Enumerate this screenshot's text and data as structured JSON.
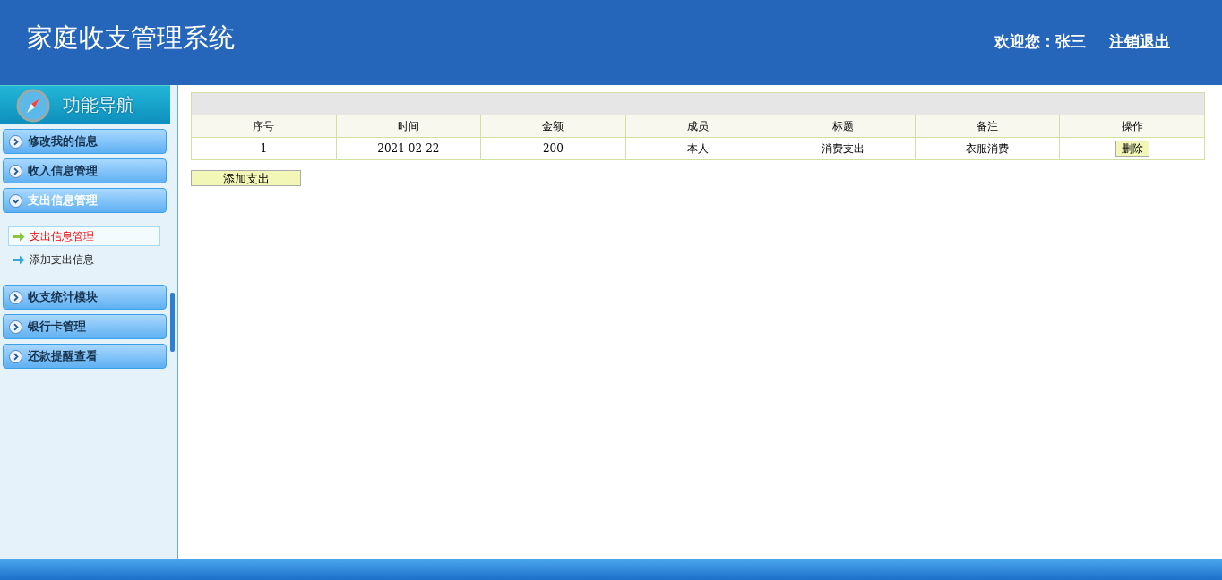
{
  "header": {
    "title": "家庭收支管理系统",
    "welcome": "欢迎您：张三",
    "logout": "注销退出"
  },
  "nav": {
    "title": "功能导航",
    "groups": [
      {
        "label": "修改我的信息",
        "expanded": false
      },
      {
        "label": "收入信息管理",
        "expanded": false
      },
      {
        "label": "支出信息管理",
        "expanded": true,
        "items": [
          {
            "label": "支出信息管理",
            "selected": true
          },
          {
            "label": "添加支出信息",
            "selected": false
          }
        ]
      },
      {
        "label": "收支统计模块",
        "expanded": false
      },
      {
        "label": "银行卡管理",
        "expanded": false
      },
      {
        "label": "还款提醒查看",
        "expanded": false
      }
    ]
  },
  "table": {
    "columns": [
      "序号",
      "时间",
      "金额",
      "成员",
      "标题",
      "备注",
      "操作"
    ],
    "rows": [
      {
        "cells": [
          "1",
          "2021-02-22",
          "200",
          "本人",
          "消费支出",
          "衣服消费"
        ],
        "action": "删除"
      }
    ]
  },
  "add_button": "添加支出"
}
